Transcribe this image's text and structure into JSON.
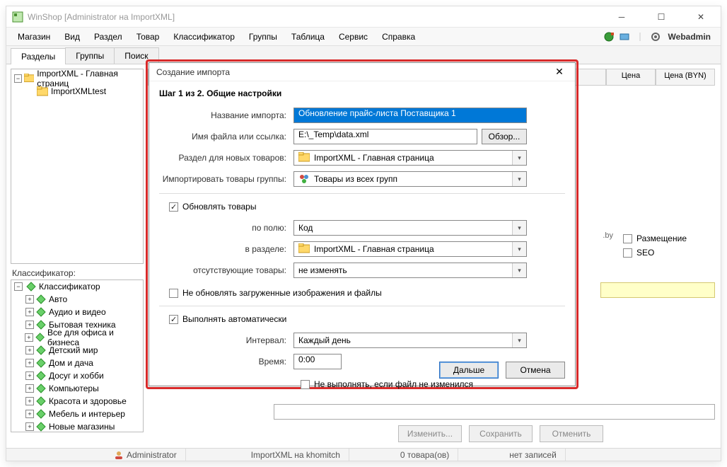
{
  "window": {
    "title": "WinShop [Administrator на ImportXML]"
  },
  "menu": {
    "items": [
      "Магазин",
      "Вид",
      "Раздел",
      "Товар",
      "Классификатор",
      "Группы",
      "Таблица",
      "Сервис",
      "Справка"
    ],
    "webadmin": "Webadmin"
  },
  "tabs": {
    "items": [
      "Разделы",
      "Группы",
      "Поиск"
    ],
    "active": 0
  },
  "tree": {
    "root": "ImportXML - Главная страниц",
    "child": "ImportXMLtest"
  },
  "classifier": {
    "title": "Классификатор:",
    "root": "Классификатор",
    "items": [
      "Авто",
      "Аудио и видео",
      "Бытовая техника",
      "Все для офиса и бизнеса",
      "Детский мир",
      "Дом и дача",
      "Досуг и хобби",
      "Компьютеры",
      "Красота и здоровье",
      "Мебель и интерьер",
      "Новые магазины"
    ]
  },
  "columns": {
    "price": "Цена",
    "price_byn": "Цена (BYN)"
  },
  "right_panel": {
    "placement": "Размещение",
    "seo": "SEO",
    "by_suffix": ".by"
  },
  "bottom_buttons": {
    "edit": "Изменить...",
    "save": "Сохранить",
    "cancel": "Отменить"
  },
  "status": {
    "admin": "Administrator",
    "db": "ImportXML на khomitch",
    "goods": "0 товара(ов)",
    "records": "нет записей"
  },
  "dialog": {
    "title": "Создание импорта",
    "step": "Шаг 1 из 2. Общие настройки",
    "labels": {
      "import_name": "Название импорта:",
      "file_name": "Имя файла или ссылка:",
      "section_new": "Раздел для новых товаров:",
      "import_group": "Импортировать товары группы:",
      "update_goods": "Обновлять товары",
      "by_field": "по полю:",
      "in_section": "в разделе:",
      "missing": "отсутствующие товары:",
      "no_update_images": "Не обновлять загруженные изображения и файлы",
      "auto_run": "Выполнять автоматически",
      "interval": "Интервал:",
      "time": "Время:",
      "skip_unchanged": "Не выполнять, если файл не изменился"
    },
    "values": {
      "import_name": "Обновление прайс-листа Поставщика 1",
      "file_name": "E:\\_Temp\\data.xml",
      "browse": "Обзор...",
      "section_new": "ImportXML - Главная страница",
      "import_group": "Товары из всех групп",
      "by_field": "Код",
      "in_section": "ImportXML - Главная страница",
      "missing": "не изменять",
      "interval": "Каждый день",
      "time": "0:00"
    },
    "buttons": {
      "next": "Дальше",
      "cancel": "Отмена"
    }
  }
}
